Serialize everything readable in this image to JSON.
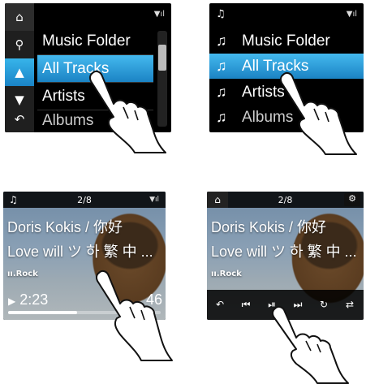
{
  "panel1": {
    "menu": [
      "Music Folder",
      "All Tracks",
      "Artists",
      "Albums"
    ],
    "selected_index": 1,
    "icons": [
      "home-icon",
      "search-icon",
      "arrow-up-icon",
      "arrow-down-icon",
      "back-icon"
    ],
    "scroll_position": 0.2
  },
  "panel2": {
    "menu": [
      "Music Folder",
      "All Tracks",
      "Artists",
      "Albums"
    ],
    "selected_index": 1,
    "icons": [
      "music-note-icon",
      "signal-icon"
    ]
  },
  "panel3": {
    "track_count": "2/8",
    "artist_line": "Doris Kokis / 你好",
    "title_line": "Love will ツ 하 繁 中 ...",
    "genre": "Rock",
    "elapsed": "2:23",
    "remaining": "46",
    "progress": 0.45
  },
  "panel4": {
    "track_count": "2/8",
    "artist_line": "Doris Kokis / 你好",
    "title_line": "Love will ツ 하 繁 中 ...",
    "genre": "Rock",
    "controls": [
      "back-icon",
      "previous-icon",
      "play-pause-icon",
      "next-icon",
      "repeat-icon",
      "shuffle-icon"
    ]
  },
  "colors": {
    "highlight": "#2a9ad8",
    "screen_bg": "#000000",
    "sidebar_bg": "#1f1f1f"
  }
}
